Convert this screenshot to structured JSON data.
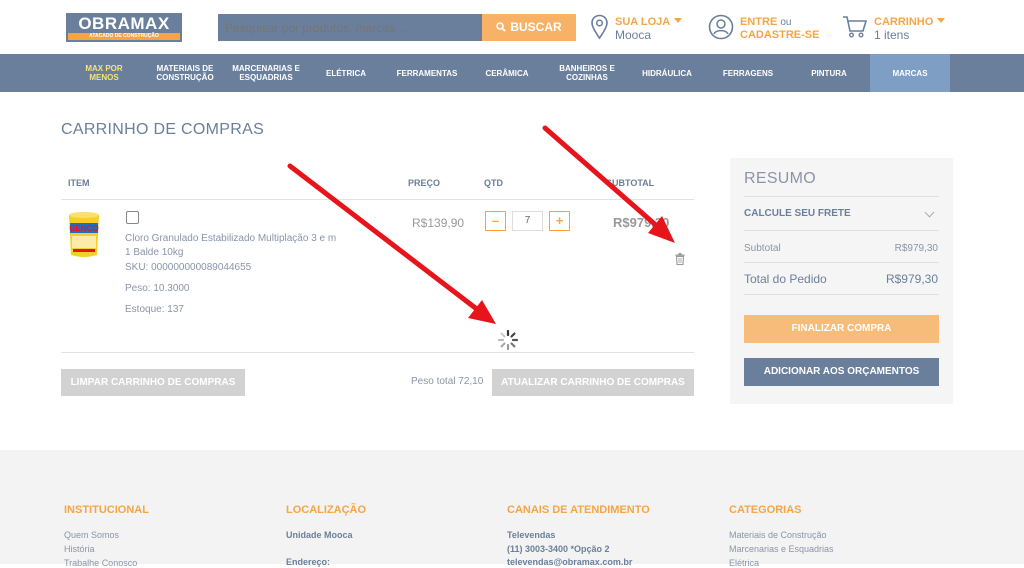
{
  "header": {
    "logo_main": "OBRAMAX",
    "logo_sub": "ATACADO DE CONSTRUÇÃO",
    "search_placeholder": "Pesquisar por produtos, marcas, ...",
    "search_button": "BUSCAR",
    "store_label": "SUA LOJA",
    "store_value": "Mooca",
    "account_line1_a": "ENTRE",
    "account_line1_b": "ou",
    "account_line2": "CADASTRE-SE",
    "cart_label": "CARRINHO",
    "cart_count": "1 itens"
  },
  "nav": [
    {
      "label": "MAX POR MENOS"
    },
    {
      "label": "MATERIAIS DE CONSTRUÇÃO"
    },
    {
      "label": "MARCENARIAS E ESQUADRIAS"
    },
    {
      "label": "ELÉTRICA"
    },
    {
      "label": "FERRAMENTAS"
    },
    {
      "label": "CERÂMICA"
    },
    {
      "label": "BANHEIROS E COZINHAS"
    },
    {
      "label": "HIDRÁULICA"
    },
    {
      "label": "FERRAGENS"
    },
    {
      "label": "PINTURA"
    },
    {
      "label": "MARCAS"
    }
  ],
  "cart": {
    "title": "CARRINHO DE COMPRAS",
    "columns": {
      "item": "ITEM",
      "price": "PREÇO",
      "qty": "QTD",
      "subtotal": "SUBTOTAL"
    },
    "item": {
      "name": "Cloro Granulado Estabilizado Multiplação 3 e m 1 Balde 10kg",
      "sku": "SKU: 000000000089044655",
      "weight": "Peso: 10.3000",
      "stock": "Estoque: 137",
      "price": "R$139,90",
      "qty": "7",
      "qty_minus": "–",
      "qty_plus": "+",
      "subtotal": "R$979,30",
      "brand_on_image": "GENCO"
    },
    "clear_button": "LIMPAR CARRINHO DE COMPRAS",
    "total_weight": "Peso total 72,10",
    "update_button": "ATUALIZAR CARRINHO DE COMPRAS"
  },
  "summary": {
    "title": "RESUMO",
    "shipping": "CALCULE SEU FRETE",
    "subtotal_label": "Subtotal",
    "subtotal_value": "R$979,30",
    "total_label": "Total do Pedido",
    "total_value": "R$979,30",
    "checkout_button": "FINALIZAR COMPRA",
    "quote_button": "ADICIONAR AOS ORÇAMENTOS"
  },
  "footer": {
    "col1": {
      "title": "INSTITUCIONAL",
      "links": [
        "Quem Somos",
        "História",
        "Trabalhe Conosco"
      ]
    },
    "col2": {
      "title": "LOCALIZAÇÃO",
      "store": "Unidade Mooca",
      "address": "Endereço:"
    },
    "col3": {
      "title": "CANAIS DE ATENDIMENTO",
      "line1": "Televendas",
      "line2": "(11) 3003-3400 *Opção 2",
      "line3": "televendas@obramax.com.br"
    },
    "col4": {
      "title": "CATEGORIAS",
      "links": [
        "Materiais de Construção",
        "Marcenarias e Esquadrias",
        "Elétrica"
      ]
    }
  },
  "colors": {
    "brand": "#6a7f9c",
    "accent": "#f7a543",
    "annotation": "#e8141b"
  },
  "icons": [
    "search-icon",
    "location-pin-icon",
    "user-icon",
    "cart-icon",
    "trash-icon",
    "loading-spinner-icon",
    "chevron-down-icon"
  ]
}
